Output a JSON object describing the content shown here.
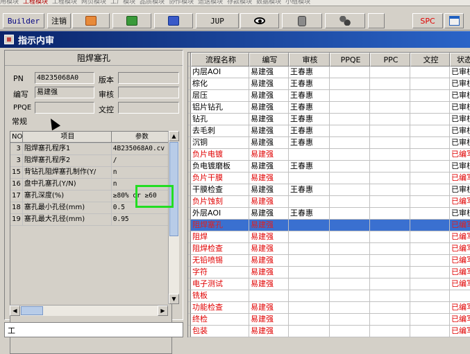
{
  "menu_strip": {
    "items": [
      "用模块",
      "工程模块",
      "工程模块",
      "网页模块",
      "工厂模块",
      "品质模块",
      "协作模块",
      "运送模块",
      "存款模块",
      "数据模块",
      "小组模块"
    ],
    "active_index": 1
  },
  "toolbar": {
    "builder_label": "Builder",
    "logout_label": "注销",
    "jup_label": "JUP",
    "spc_label": "SPC",
    "icons": [
      "ppt-icon",
      "excel-icon",
      "word-icon",
      "eye-icon",
      "database-icon",
      "network-icon",
      "window-icon"
    ]
  },
  "window": {
    "title": "指示内审"
  },
  "left": {
    "heading": "阻焊塞孔",
    "pn_label": "PN",
    "pn_value": "4B235068A0",
    "version_label": "版本",
    "version_value": "",
    "writer_label": "编写",
    "writer_value": "易建强",
    "review_label": "审核",
    "review_value": "",
    "ppqe_label": "PPQE",
    "ppqe_value": "",
    "doc_control_label": "文控",
    "doc_control_value": "",
    "tab_label": "常规",
    "grid_headers": {
      "no": "NO",
      "item": "项目",
      "param": "参数"
    },
    "grid_rows": [
      {
        "no": "3",
        "item": "阻焊塞孔程序1",
        "param": "4B235068A0.cv"
      },
      {
        "no": "3",
        "item": "阻焊塞孔程序2",
        "param": "/"
      },
      {
        "no": "15",
        "item": "背钻孔阻焊塞孔制作(Y/",
        "param": "n"
      },
      {
        "no": "16",
        "item": "盘中孔塞孔(Y/N)",
        "param": "n"
      },
      {
        "no": "17",
        "item": "塞孔深度(%)",
        "param": "≥80% or ≥60"
      },
      {
        "no": "18",
        "item": "塞孔最小孔径(mm)",
        "param": "0.5"
      },
      {
        "no": "19",
        "item": "塞孔最大孔径(mm)",
        "param": "0.95"
      }
    ],
    "bottom_label": "工"
  },
  "right": {
    "headers": [
      "流程名称",
      "编写",
      "审核",
      "PPQE",
      "PPC",
      "文控",
      "状态"
    ],
    "rows": [
      {
        "name": "内层AOI",
        "writer": "易建强",
        "reviewer": "王春惠",
        "status": "已审核",
        "style": "normal"
      },
      {
        "name": "棕化",
        "writer": "易建强",
        "reviewer": "王春惠",
        "status": "已审核",
        "style": "normal"
      },
      {
        "name": "层压",
        "writer": "易建强",
        "reviewer": "王春惠",
        "status": "已审核",
        "style": "normal"
      },
      {
        "name": "铝片钻孔",
        "writer": "易建强",
        "reviewer": "王春惠",
        "status": "已审核",
        "style": "normal"
      },
      {
        "name": "钻孔",
        "writer": "易建强",
        "reviewer": "王春惠",
        "status": "已审核",
        "style": "normal"
      },
      {
        "name": "去毛刺",
        "writer": "易建强",
        "reviewer": "王春惠",
        "status": "已审核",
        "style": "normal"
      },
      {
        "name": "沉铜",
        "writer": "易建强",
        "reviewer": "王春惠",
        "status": "已审核",
        "style": "normal"
      },
      {
        "name": "负片电镀",
        "writer": "易建强",
        "reviewer": "",
        "status": "已编写",
        "style": "red"
      },
      {
        "name": "负电镀磨板",
        "writer": "易建强",
        "reviewer": "王春惠",
        "status": "已审核",
        "style": "normal"
      },
      {
        "name": "负片干膜",
        "writer": "易建强",
        "reviewer": "",
        "status": "已编写",
        "style": "red"
      },
      {
        "name": "干膜检查",
        "writer": "易建强",
        "reviewer": "王春惠",
        "status": "已审核",
        "style": "normal"
      },
      {
        "name": "负片蚀刻",
        "writer": "易建强",
        "reviewer": "",
        "status": "已编写",
        "style": "red"
      },
      {
        "name": "外层AOI",
        "writer": "易建强",
        "reviewer": "王春惠",
        "status": "已审核",
        "style": "normal"
      },
      {
        "name": "阻焊塞孔",
        "writer": "易建强",
        "reviewer": "",
        "status": "已编写",
        "style": "selected"
      },
      {
        "name": "阻焊",
        "writer": "易建强",
        "reviewer": "",
        "status": "已编写",
        "style": "red"
      },
      {
        "name": "阻焊检查",
        "writer": "易建强",
        "reviewer": "",
        "status": "已编写",
        "style": "red"
      },
      {
        "name": "无铅喷锡",
        "writer": "易建强",
        "reviewer": "",
        "status": "已编写",
        "style": "red"
      },
      {
        "name": "字符",
        "writer": "易建强",
        "reviewer": "",
        "status": "已编写",
        "style": "red"
      },
      {
        "name": "电子测试",
        "writer": "易建强",
        "reviewer": "",
        "status": "已编写",
        "style": "red"
      },
      {
        "name": "铣板",
        "writer": "",
        "reviewer": "",
        "status": "",
        "style": "red"
      },
      {
        "name": "功能检查",
        "writer": "易建强",
        "reviewer": "",
        "status": "已编写",
        "style": "red"
      },
      {
        "name": "终检",
        "writer": "易建强",
        "reviewer": "",
        "status": "已编写",
        "style": "red"
      },
      {
        "name": "包装",
        "writer": "易建强",
        "reviewer": "",
        "status": "已编写",
        "style": "red"
      }
    ]
  },
  "colors": {
    "title_bar": "#0a246a",
    "red_text": "#e00000",
    "selection": "#3a70d0",
    "highlight_box": "#22dd22"
  }
}
